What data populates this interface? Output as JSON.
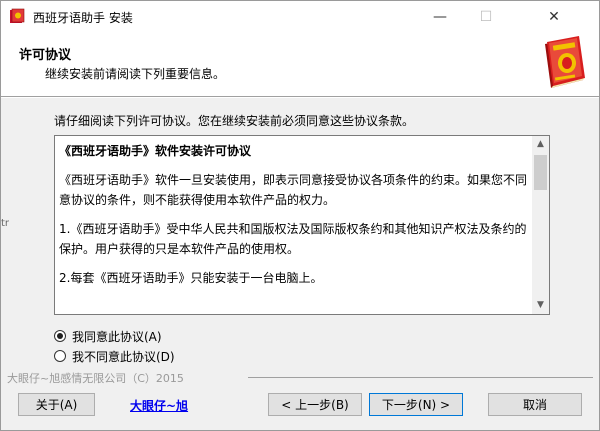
{
  "window": {
    "title": "西班牙语助手 安装",
    "controls": {
      "minimize": "—",
      "maximize": "☐",
      "close": "✕"
    }
  },
  "header": {
    "title": "许可协议",
    "subtitle": "继续安装前请阅读下列重要信息。"
  },
  "main": {
    "prompt": "请仔细阅读下列许可协议。您在继续安装前必须同意这些协议条款。",
    "license": {
      "heading": "《西班牙语助手》软件安装许可协议",
      "paragraphs": [
        "《西班牙语助手》软件一旦安装使用，即表示同意接受协议各项条件的约束。如果您不同意协议的条件，则不能获得使用本软件产品的权力。",
        "1.《西班牙语助手》受中华人民共和国版权法及国际版权条约和其他知识产权法及条约的保护。用户获得的只是本软件产品的使用权。",
        "2.每套《西班牙语助手》只能安装于一台电脑上。"
      ]
    },
    "radios": {
      "accept": "我同意此协议(A)",
      "decline": "我不同意此协议(D)",
      "selected": "accept"
    },
    "side_mark": "tr"
  },
  "footer": {
    "copyright": "大眼仔~旭感情无限公司（C）2015",
    "about": "关于(A)",
    "link": "大眼仔~旭",
    "back": "< 上一步(B)",
    "next": "下一步(N) >",
    "cancel": "取消"
  },
  "colors": {
    "accent": "#0078d7",
    "link": "#0000ee",
    "book_red": "#c8102e",
    "book_gold": "#f2c200"
  }
}
